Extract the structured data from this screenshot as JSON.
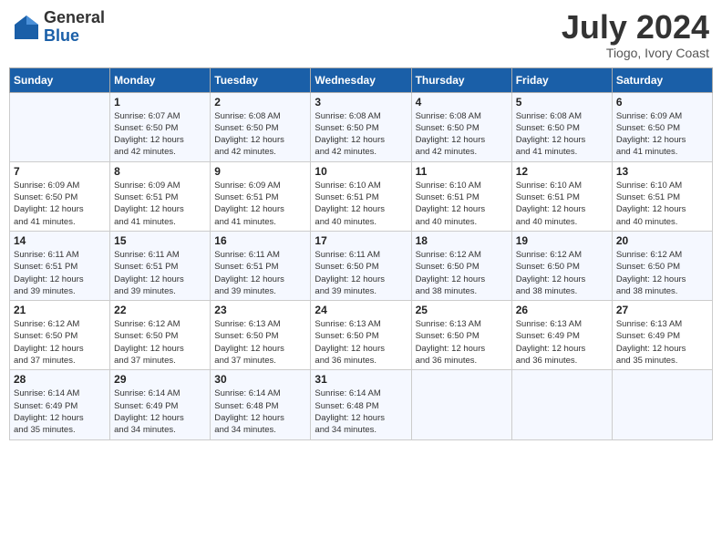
{
  "header": {
    "logo_general": "General",
    "logo_blue": "Blue",
    "month_year": "July 2024",
    "location": "Tiogo, Ivory Coast"
  },
  "weekdays": [
    "Sunday",
    "Monday",
    "Tuesday",
    "Wednesday",
    "Thursday",
    "Friday",
    "Saturday"
  ],
  "weeks": [
    [
      {
        "day": "",
        "sunrise": "",
        "sunset": "",
        "daylight": ""
      },
      {
        "day": "1",
        "sunrise": "6:07 AM",
        "sunset": "6:50 PM",
        "daylight": "12 hours and 42 minutes."
      },
      {
        "day": "2",
        "sunrise": "6:08 AM",
        "sunset": "6:50 PM",
        "daylight": "12 hours and 42 minutes."
      },
      {
        "day": "3",
        "sunrise": "6:08 AM",
        "sunset": "6:50 PM",
        "daylight": "12 hours and 42 minutes."
      },
      {
        "day": "4",
        "sunrise": "6:08 AM",
        "sunset": "6:50 PM",
        "daylight": "12 hours and 42 minutes."
      },
      {
        "day": "5",
        "sunrise": "6:08 AM",
        "sunset": "6:50 PM",
        "daylight": "12 hours and 41 minutes."
      },
      {
        "day": "6",
        "sunrise": "6:09 AM",
        "sunset": "6:50 PM",
        "daylight": "12 hours and 41 minutes."
      }
    ],
    [
      {
        "day": "7",
        "sunrise": "6:09 AM",
        "sunset": "6:50 PM",
        "daylight": "12 hours and 41 minutes."
      },
      {
        "day": "8",
        "sunrise": "6:09 AM",
        "sunset": "6:51 PM",
        "daylight": "12 hours and 41 minutes."
      },
      {
        "day": "9",
        "sunrise": "6:09 AM",
        "sunset": "6:51 PM",
        "daylight": "12 hours and 41 minutes."
      },
      {
        "day": "10",
        "sunrise": "6:10 AM",
        "sunset": "6:51 PM",
        "daylight": "12 hours and 40 minutes."
      },
      {
        "day": "11",
        "sunrise": "6:10 AM",
        "sunset": "6:51 PM",
        "daylight": "12 hours and 40 minutes."
      },
      {
        "day": "12",
        "sunrise": "6:10 AM",
        "sunset": "6:51 PM",
        "daylight": "12 hours and 40 minutes."
      },
      {
        "day": "13",
        "sunrise": "6:10 AM",
        "sunset": "6:51 PM",
        "daylight": "12 hours and 40 minutes."
      }
    ],
    [
      {
        "day": "14",
        "sunrise": "6:11 AM",
        "sunset": "6:51 PM",
        "daylight": "12 hours and 39 minutes."
      },
      {
        "day": "15",
        "sunrise": "6:11 AM",
        "sunset": "6:51 PM",
        "daylight": "12 hours and 39 minutes."
      },
      {
        "day": "16",
        "sunrise": "6:11 AM",
        "sunset": "6:51 PM",
        "daylight": "12 hours and 39 minutes."
      },
      {
        "day": "17",
        "sunrise": "6:11 AM",
        "sunset": "6:50 PM",
        "daylight": "12 hours and 39 minutes."
      },
      {
        "day": "18",
        "sunrise": "6:12 AM",
        "sunset": "6:50 PM",
        "daylight": "12 hours and 38 minutes."
      },
      {
        "day": "19",
        "sunrise": "6:12 AM",
        "sunset": "6:50 PM",
        "daylight": "12 hours and 38 minutes."
      },
      {
        "day": "20",
        "sunrise": "6:12 AM",
        "sunset": "6:50 PM",
        "daylight": "12 hours and 38 minutes."
      }
    ],
    [
      {
        "day": "21",
        "sunrise": "6:12 AM",
        "sunset": "6:50 PM",
        "daylight": "12 hours and 37 minutes."
      },
      {
        "day": "22",
        "sunrise": "6:12 AM",
        "sunset": "6:50 PM",
        "daylight": "12 hours and 37 minutes."
      },
      {
        "day": "23",
        "sunrise": "6:13 AM",
        "sunset": "6:50 PM",
        "daylight": "12 hours and 37 minutes."
      },
      {
        "day": "24",
        "sunrise": "6:13 AM",
        "sunset": "6:50 PM",
        "daylight": "12 hours and 36 minutes."
      },
      {
        "day": "25",
        "sunrise": "6:13 AM",
        "sunset": "6:50 PM",
        "daylight": "12 hours and 36 minutes."
      },
      {
        "day": "26",
        "sunrise": "6:13 AM",
        "sunset": "6:49 PM",
        "daylight": "12 hours and 36 minutes."
      },
      {
        "day": "27",
        "sunrise": "6:13 AM",
        "sunset": "6:49 PM",
        "daylight": "12 hours and 35 minutes."
      }
    ],
    [
      {
        "day": "28",
        "sunrise": "6:14 AM",
        "sunset": "6:49 PM",
        "daylight": "12 hours and 35 minutes."
      },
      {
        "day": "29",
        "sunrise": "6:14 AM",
        "sunset": "6:49 PM",
        "daylight": "12 hours and 34 minutes."
      },
      {
        "day": "30",
        "sunrise": "6:14 AM",
        "sunset": "6:48 PM",
        "daylight": "12 hours and 34 minutes."
      },
      {
        "day": "31",
        "sunrise": "6:14 AM",
        "sunset": "6:48 PM",
        "daylight": "12 hours and 34 minutes."
      },
      {
        "day": "",
        "sunrise": "",
        "sunset": "",
        "daylight": ""
      },
      {
        "day": "",
        "sunrise": "",
        "sunset": "",
        "daylight": ""
      },
      {
        "day": "",
        "sunrise": "",
        "sunset": "",
        "daylight": ""
      }
    ]
  ]
}
